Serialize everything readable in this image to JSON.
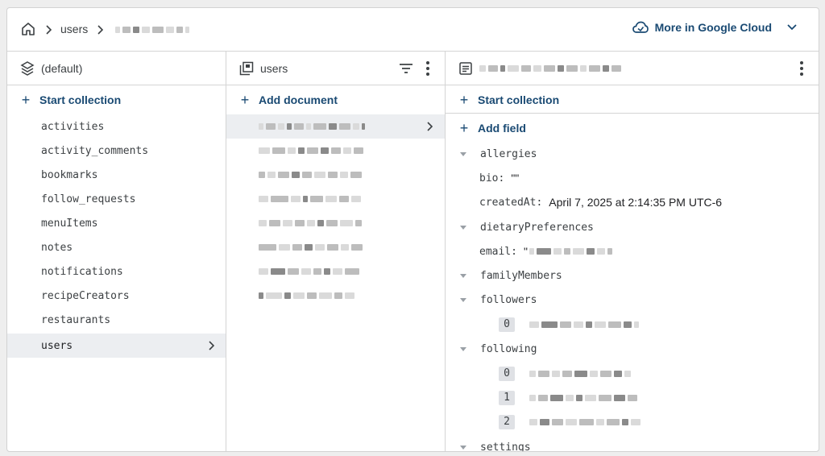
{
  "breadcrumb": {
    "home_icon": "home-icon",
    "users_label": "users"
  },
  "google_cloud": {
    "label": "More in Google Cloud",
    "icon": "cloud-icon",
    "accent": "#1a4a73"
  },
  "panel1": {
    "database_label": "(default)",
    "start_collection_label": "Start collection",
    "collections": [
      "activities",
      "activity_comments",
      "bookmarks",
      "follow_requests",
      "menuItems",
      "notes",
      "notifications",
      "recipeCreators",
      "restaurants",
      "users"
    ],
    "selected_collection": "users"
  },
  "panel2": {
    "collection_label": "users",
    "add_document_label": "Add document"
  },
  "panel3": {
    "start_collection_label": "Start collection",
    "add_field_label": "Add field",
    "fields": {
      "allergies": "allergies",
      "bio_key": "bio:",
      "bio_val": "\"\"",
      "created_key": "createdAt:",
      "created_val": "April 7, 2025 at 2:14:35 PM UTC-6",
      "dietary": "dietaryPreferences",
      "email_key": "email:",
      "email_val_prefix": "\"",
      "family": "familyMembers",
      "followers": "followers",
      "followers_idx": [
        "0"
      ],
      "following": "following",
      "following_idx": [
        "0",
        "1",
        "2"
      ],
      "settings": "settings"
    }
  }
}
